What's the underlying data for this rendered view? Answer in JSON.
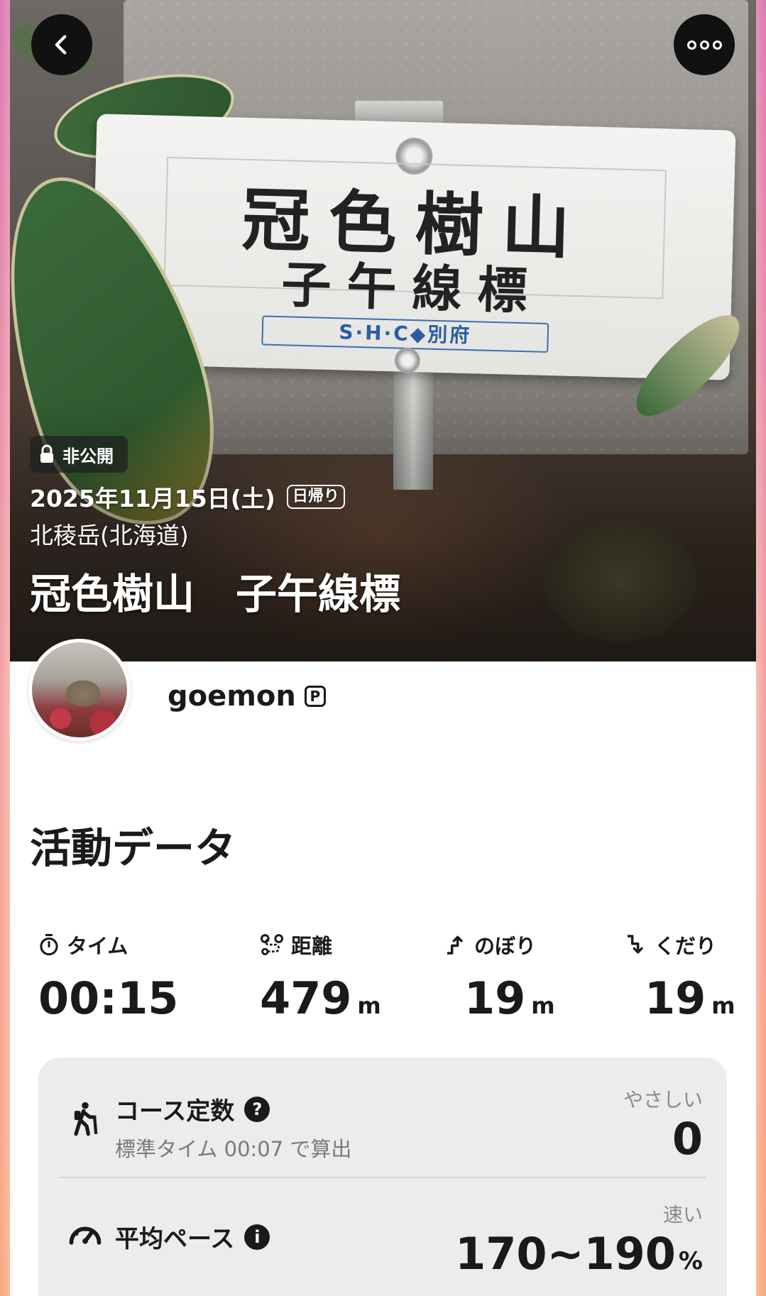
{
  "header": {
    "back_icon": "chevron-left-icon",
    "more_icon": "more-horizontal-icon"
  },
  "photo_sign": {
    "title": "冠色樹山",
    "subtitle": "子午線標",
    "brand": "S·H·C◆別府"
  },
  "record": {
    "visibility": "非公開",
    "date": "2025年11月15日(土)",
    "trip_type": "日帰り",
    "location": "北稜岳(北海道)",
    "title": "冠色樹山　子午線標"
  },
  "user": {
    "name": "goemon",
    "badge": "P"
  },
  "activity": {
    "section_title": "活動データ",
    "stats": [
      {
        "label": "タイム",
        "icon": "stopwatch-icon",
        "value": "00:15",
        "unit": ""
      },
      {
        "label": "距離",
        "icon": "route-icon",
        "value": "479",
        "unit": "m"
      },
      {
        "label": "のぼり",
        "icon": "ascent-icon",
        "value": "19",
        "unit": "m"
      },
      {
        "label": "くだり",
        "icon": "descent-icon",
        "value": "19",
        "unit": "m"
      }
    ],
    "course_constant": {
      "title": "コース定数",
      "help": "?",
      "sub": "標準タイム 00:07 で算出",
      "tag": "やさしい",
      "value": "0"
    },
    "avg_pace": {
      "title": "平均ペース",
      "info": "i",
      "tag": "速い",
      "value": "170~190",
      "unit": "%"
    }
  },
  "colors": {
    "accent_frame_top": "#d25aa0",
    "accent_frame_bottom": "#ffaa5a",
    "text": "#1a1a1a",
    "muted": "#7a7a7a",
    "panel": "#ececec"
  }
}
